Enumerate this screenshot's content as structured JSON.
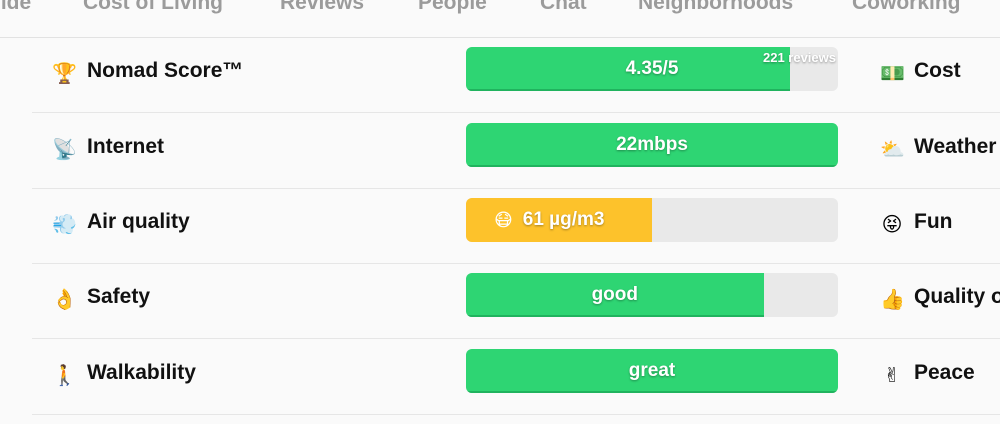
{
  "tabs": [
    "uide",
    "Cost of Living",
    "Reviews",
    "People",
    "Chat",
    "Neighborhoods",
    "Coworking"
  ],
  "rows": [
    {
      "emoji": "🏆",
      "emoji_name": "trophy-icon",
      "label": "Nomad Score™",
      "bar_text": "4.35/5",
      "fill_fraction": 0.87,
      "fill_color": "#2ed573",
      "reviews_text": "221 reviews",
      "right_emoji": "💵",
      "right_emoji_name": "money-icon",
      "right_label": "Cost"
    },
    {
      "emoji": "📡",
      "emoji_name": "satellite-dish-icon",
      "label": "Internet",
      "bar_text": "22mbps",
      "fill_fraction": 1.0,
      "fill_color": "#2ed573",
      "right_emoji": "⛅",
      "right_emoji_name": "weather-cloud-icon",
      "right_label": "Weather"
    },
    {
      "emoji": "💨",
      "emoji_name": "air-puff-icon",
      "label": "Air quality",
      "bar_emoji": "😷",
      "bar_text": "61 µg/m3",
      "fill_fraction": 0.5,
      "fill_color": "#fdc22b",
      "right_emoji": "😝",
      "right_emoji_name": "tongue-face-icon",
      "right_label": "Fun"
    },
    {
      "emoji": "👌",
      "emoji_name": "ok-hand-icon",
      "label": "Safety",
      "bar_text": "good",
      "fill_fraction": 0.8,
      "fill_color": "#2ed573",
      "right_emoji": "👍",
      "right_emoji_name": "thumbs-up-icon",
      "right_label": "Quality of"
    },
    {
      "emoji": "🚶",
      "emoji_name": "walking-person-icon",
      "label": "Walkability",
      "bar_text": "great",
      "fill_fraction": 1.0,
      "fill_color": "#2ed573",
      "right_emoji": "✌",
      "right_emoji_name": "peace-hand-icon",
      "right_label": "Peace"
    }
  ]
}
